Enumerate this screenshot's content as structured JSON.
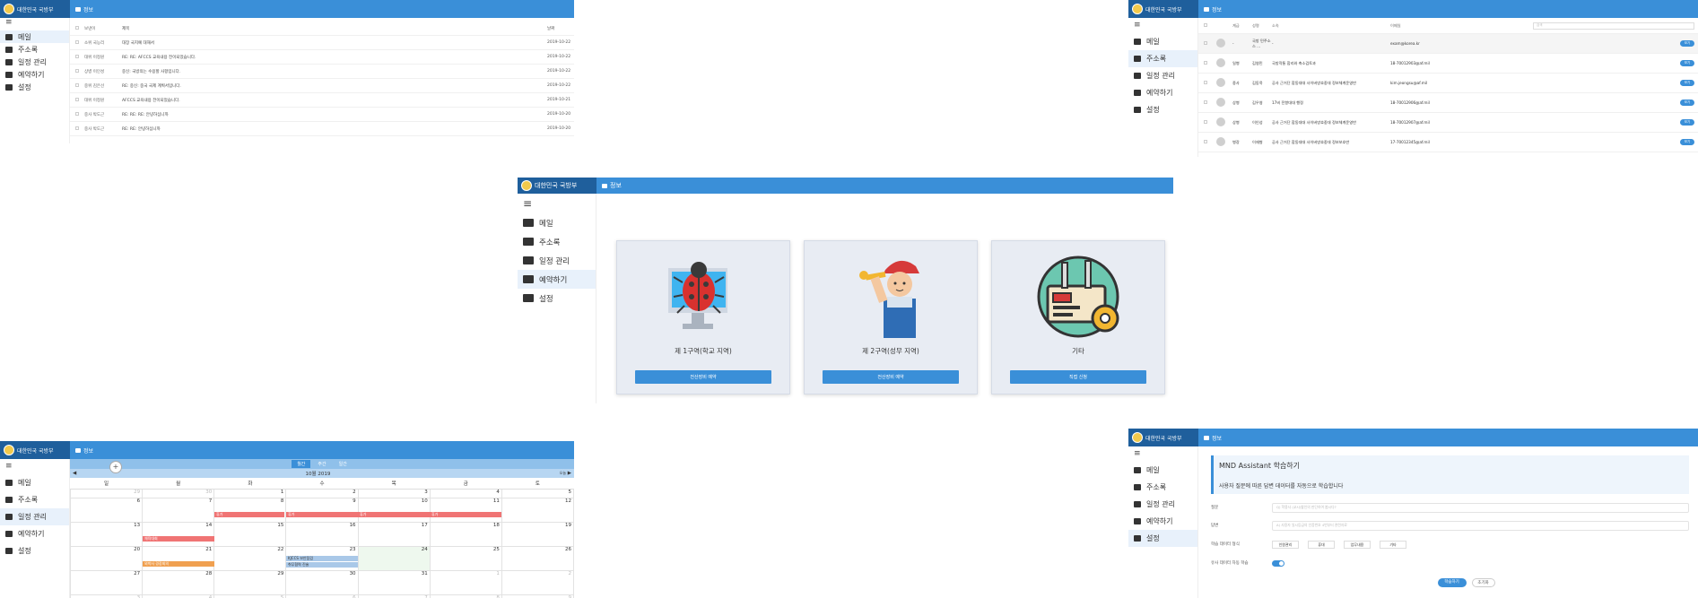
{
  "brand": "대한민국 국방부",
  "crumb": "정보",
  "menu": [
    "메일",
    "주소록",
    "일정 관리",
    "예약하기",
    "설정"
  ],
  "mail": {
    "headers": [
      "보낸이",
      "제목",
      "날짜"
    ],
    "rows": [
      {
        "from": "소위 국능리",
        "subject": "대장 국지예 대해서",
        "date": "2019-10-22"
      },
      {
        "from": "대위 이정원",
        "subject": "RE: RE: AFCCS 교육내용 전이되었습니다.",
        "date": "2019-10-22"
      },
      {
        "from": "상병 이인성",
        "subject": "중신: 국방의는 수용할 사항입니다.",
        "date": "2019-10-22"
      },
      {
        "from": "중위 김은선",
        "subject": "RE: 중신: 중국 국제 계획서입니다.",
        "date": "2019-10-22"
      },
      {
        "from": "대위 이정원",
        "subject": "AFCCS 교육내용 전이되었습니다.",
        "date": "2019-10-21"
      },
      {
        "from": "중사 박도근",
        "subject": "RE: RE: RE: 안녕하십니까",
        "date": "2019-10-20"
      },
      {
        "from": "중사 박도근",
        "subject": "RE: RE: 안녕하십니까",
        "date": "2019-10-20"
      }
    ]
  },
  "address": {
    "headers": [
      "계급",
      "성명",
      "소속",
      "이메일"
    ],
    "search_placeholder": "검색",
    "rows": [
      {
        "rank": "-",
        "name": "국방 민주소스 ...",
        "unit": "-",
        "email": "exam@korea.kr",
        "btn": "보기"
      },
      {
        "rank": "일병",
        "name": "김영민",
        "unit": "국방작통 합리와 축소검토과",
        "email": "18-70012903@af.mil",
        "btn": "보기"
      },
      {
        "rank": "중사",
        "name": "김동욱",
        "unit": "공사 근거단 합동대대 사이버방호중대 정보체계운영반",
        "email": "kim.jeongsu@af.mil",
        "btn": "보기"
      },
      {
        "rank": "상병",
        "name": "김우영",
        "unit": "17비 전항대대 행정",
        "email": "18-70012906@af.mil",
        "btn": "보기"
      },
      {
        "rank": "상병",
        "name": "이인성",
        "unit": "공사 근거단 합동대대 사이버방호중대 정보체계운영반",
        "email": "18-70012907@af.mil",
        "btn": "보기"
      },
      {
        "rank": "병장",
        "name": "이재형",
        "unit": "공사 근거단 합동대대 사이버방호중대 정보보호반",
        "email": "17-70012345@af.mil",
        "btn": "보기"
      }
    ]
  },
  "reserve": {
    "cards": [
      {
        "title": "제 1구역(학교 지역)",
        "button": "전산장비 예약"
      },
      {
        "title": "제 2구역(성무 지역)",
        "button": "전산장비 예약"
      },
      {
        "title": "기타",
        "button": "직접 신청"
      }
    ]
  },
  "calendar": {
    "views": [
      "월간",
      "주간",
      "일간"
    ],
    "month": "10월 2019",
    "today_label": "오늘",
    "weekdays": [
      "일",
      "월",
      "화",
      "수",
      "목",
      "금",
      "토"
    ],
    "weeks": [
      [
        "29",
        "30",
        "1",
        "2",
        "3",
        "4",
        "5"
      ],
      [
        "6",
        "7",
        "8",
        "9",
        "10",
        "11",
        "12"
      ],
      [
        "13",
        "14",
        "15",
        "16",
        "17",
        "18",
        "19"
      ],
      [
        "20",
        "21",
        "22",
        "23",
        "24",
        "25",
        "26"
      ],
      [
        "27",
        "28",
        "29",
        "30",
        "31",
        "1",
        "2"
      ],
      [
        "3",
        "4",
        "5",
        "6",
        "7",
        "8",
        "9"
      ]
    ],
    "events": [
      {
        "label": "휴가",
        "color": "#f07474"
      },
      {
        "label": "휴가",
        "color": "#f07474"
      },
      {
        "label": "휴가",
        "color": "#f07474"
      },
      {
        "label": "휴가",
        "color": "#f07474"
      },
      {
        "label": "체육대회",
        "color": "#f07474"
      },
      {
        "label": "외박사 경장회의",
        "color": "#f0a050"
      },
      {
        "label": "KJCCS 보안점검",
        "color": "#a9c8e8"
      },
      {
        "label": "취무협력 진술",
        "color": "#a9c8e8"
      }
    ]
  },
  "assistant": {
    "title": "MND Assistant 학습하기",
    "subtitle": "사용자 질문에 따른 답변 데이터를 자동으로 학습합니다",
    "q_label": "질문",
    "q_placeholder": "Q) 학용사 (교시)할인의 판단하여 봅시다?",
    "a_label": "답변",
    "a_placeholder": "A) 사용자 일시등급의 인증번호 4번부터 관련자료",
    "type_label": "학습 데이터 형식",
    "types": [
      "인원관리",
      "휴대",
      "업무내용",
      "기타"
    ],
    "auto_label": "유사 데이터 자동 학습",
    "submit": "학습하기",
    "reset": "초기화"
  }
}
